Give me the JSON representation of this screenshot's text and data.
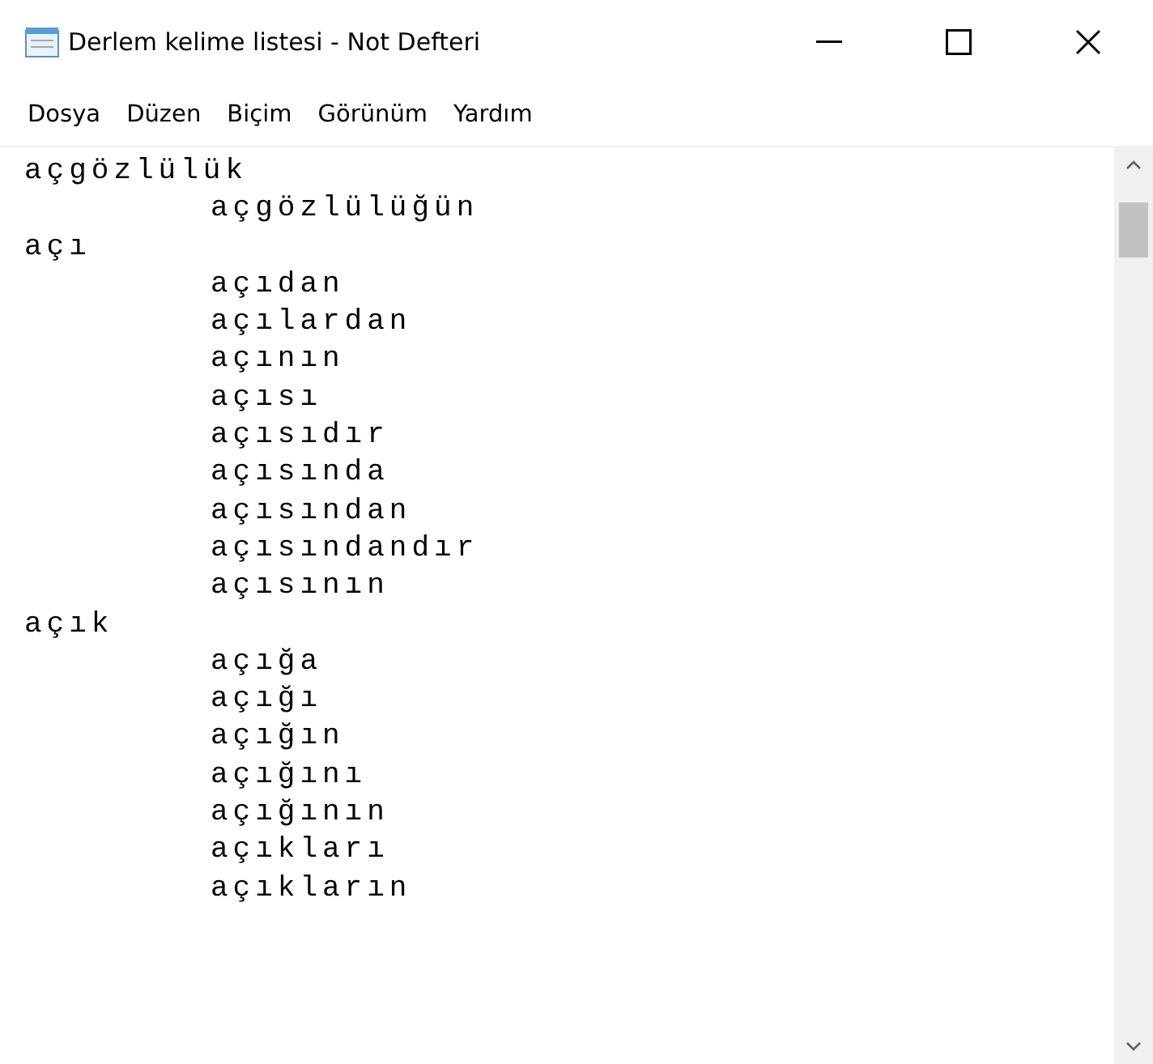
{
  "window": {
    "title": "Derlem kelime listesi - Not Defteri"
  },
  "menu": [
    "Dosya",
    "Düzen",
    "Biçim",
    "Görünüm",
    "Yardım"
  ],
  "document": {
    "lines": [
      {
        "text": "açgözlülük",
        "children": [
          {
            "text": "açgözlülüğün"
          }
        ]
      },
      {
        "text": "açı",
        "children": [
          {
            "text": "açıdan"
          },
          {
            "text": "açılardan"
          },
          {
            "text": "açının"
          },
          {
            "text": "açısı"
          },
          {
            "text": "açısıdır"
          },
          {
            "text": "açısında"
          },
          {
            "text": "açısından"
          },
          {
            "text": "açısındandır"
          },
          {
            "text": "açısının"
          }
        ]
      },
      {
        "text": "açık",
        "children": [
          {
            "text": "açığa"
          },
          {
            "text": "açığı"
          },
          {
            "text": "açığın"
          },
          {
            "text": "açığını"
          },
          {
            "text": "açığının"
          },
          {
            "text": "açıkları"
          },
          {
            "text": "açıkların"
          }
        ]
      }
    ]
  }
}
